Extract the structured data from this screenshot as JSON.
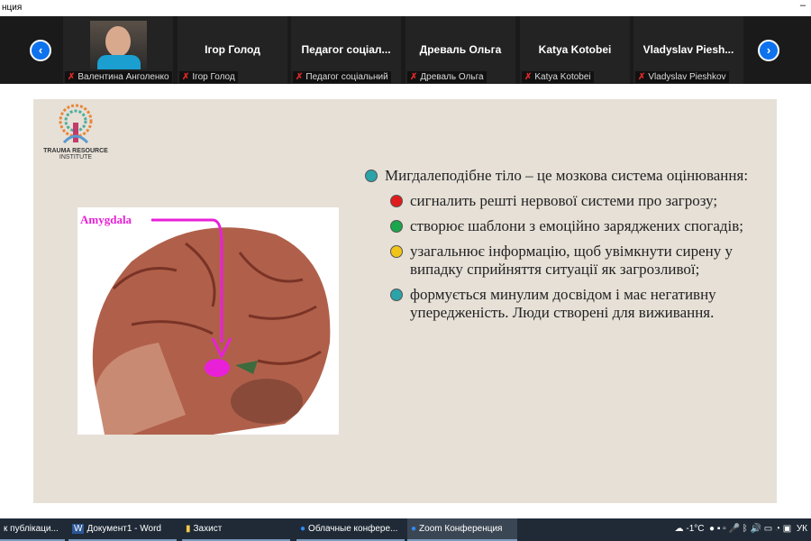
{
  "window": {
    "title": "нция",
    "minimize": "–"
  },
  "gallery": {
    "prev": "‹",
    "next": "›",
    "tiles": [
      {
        "big": "",
        "label": "Валентина Анголенко",
        "video": true
      },
      {
        "big": "Ігор Голод",
        "label": "Ігор Голод"
      },
      {
        "big": "Педагог  соціал...",
        "label": "Педагог соціальний"
      },
      {
        "big": "Древаль Ольга",
        "label": "Древаль Ольга"
      },
      {
        "big": "Katya Kotobei",
        "label": "Katya Kotobei"
      },
      {
        "big": "Vladyslav  Piesh...",
        "label": "Vladyslav Pieshkov"
      }
    ]
  },
  "slide": {
    "logo_text": "TRAUMA RESOURCE INSTITUTE",
    "logo_line1": "TRAUMA RESOURCE",
    "logo_line2": "INSTITUTE",
    "image_label": "Amygdala",
    "main": "Мигдалеподібне тіло – це мозкова система оцінювання:",
    "bullets": [
      {
        "text": "сигналить решті нервової системи про загрозу;",
        "color": "#e01b1b"
      },
      {
        "text": "створює шаблони з емоційно заряджених спогадів;",
        "color": "#1aa64a"
      },
      {
        "text": "узагальнює інформацію, щоб увімкнути сирену у випадку сприйняття ситуації як загрозливої;",
        "color": "#f0c419"
      },
      {
        "text": "формується минулим досвідом і має негативну упередженість. Люди створені для виживання.",
        "color": "#2ba3a8"
      }
    ],
    "main_color": "#2ba3a8"
  },
  "taskbar": {
    "items": [
      "к публікаци...",
      "Документ1 - Word",
      "Захист",
      "Облачные конфере...",
      "Zoom Конференция"
    ],
    "weather": "-1°C",
    "lang": "УК"
  }
}
